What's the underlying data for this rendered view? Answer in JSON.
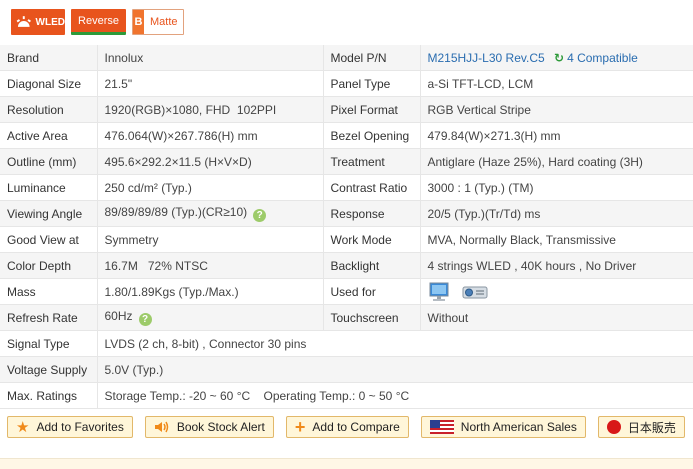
{
  "badges": {
    "wled": "WLED",
    "reverse": "Reverse",
    "matte_letter": "B",
    "matte": "Matte"
  },
  "specs": {
    "brand": {
      "label": "Brand",
      "value": "Innolux"
    },
    "model": {
      "label": "Model P/N",
      "value": "M215HJJ-L30 Rev.C5",
      "compatible": "4 Compatible"
    },
    "diagonal": {
      "label": "Diagonal Size",
      "value": "21.5\""
    },
    "panel_type": {
      "label": "Panel Type",
      "value": "a-Si TFT-LCD, LCM"
    },
    "resolution": {
      "label": "Resolution",
      "value": "1920(RGB)×1080, FHD  102PPI"
    },
    "pixel_format": {
      "label": "Pixel Format",
      "value": "RGB Vertical Stripe"
    },
    "active_area": {
      "label": "Active Area",
      "value": "476.064(W)×267.786(H) mm"
    },
    "bezel": {
      "label": "Bezel Opening",
      "value": "479.84(W)×271.3(H) mm"
    },
    "outline": {
      "label": "Outline (mm)",
      "value": "495.6×292.2×11.5 (H×V×D)"
    },
    "treatment": {
      "label": "Treatment",
      "value": "Antiglare (Haze 25%), Hard coating (3H)"
    },
    "luminance": {
      "label": "Luminance",
      "value": "250 cd/m² (Typ.)"
    },
    "contrast": {
      "label": "Contrast Ratio",
      "value": "3000 : 1 (Typ.) (TM)"
    },
    "viewing": {
      "label": "Viewing Angle",
      "value": "89/89/89/89 (Typ.)(CR≥10)"
    },
    "response": {
      "label": "Response",
      "value": "20/5 (Typ.)(Tr/Td) ms"
    },
    "good_view": {
      "label": "Good View at",
      "value": "Symmetry"
    },
    "work_mode": {
      "label": "Work Mode",
      "value": "MVA, Normally Black, Transmissive"
    },
    "color_depth": {
      "label": "Color Depth",
      "value": "16.7M   72% NTSC"
    },
    "backlight": {
      "label": "Backlight",
      "value": "4 strings WLED , 40K hours , No Driver"
    },
    "mass": {
      "label": "Mass",
      "value": "1.80/1.89Kgs (Typ./Max.)"
    },
    "used_for": {
      "label": "Used for"
    },
    "refresh": {
      "label": "Refresh Rate",
      "value": "60Hz"
    },
    "touchscreen": {
      "label": "Touchscreen",
      "value": "Without"
    },
    "signal": {
      "label": "Signal Type",
      "value": "LVDS (2 ch, 8-bit) , Connector 30 pins"
    },
    "voltage": {
      "label": "Voltage Supply",
      "value": "5.0V (Typ.)"
    },
    "max_ratings": {
      "label": "Max. Ratings",
      "value": "Storage Temp.: -20 ~ 60 °C    Operating Temp.: 0 ~ 50 °C"
    }
  },
  "help_glyph": "?",
  "actions": {
    "favorites": "Add to Favorites",
    "stock_alert": "Book Stock Alert",
    "compare": "Add to Compare",
    "na_sales": "North American Sales",
    "japan": "日本販売"
  },
  "icons": [
    "bulb-icon",
    "recycle-icon",
    "help-icon",
    "monitor-icon",
    "projector-icon",
    "star-icon",
    "speaker-icon",
    "plus-icon",
    "us-flag-icon",
    "japan-flag-icon"
  ],
  "colors": {
    "accent": "#e8541d",
    "link": "#2a6db0",
    "button_bg": "#fff6d9",
    "button_border": "#e2b86a"
  }
}
